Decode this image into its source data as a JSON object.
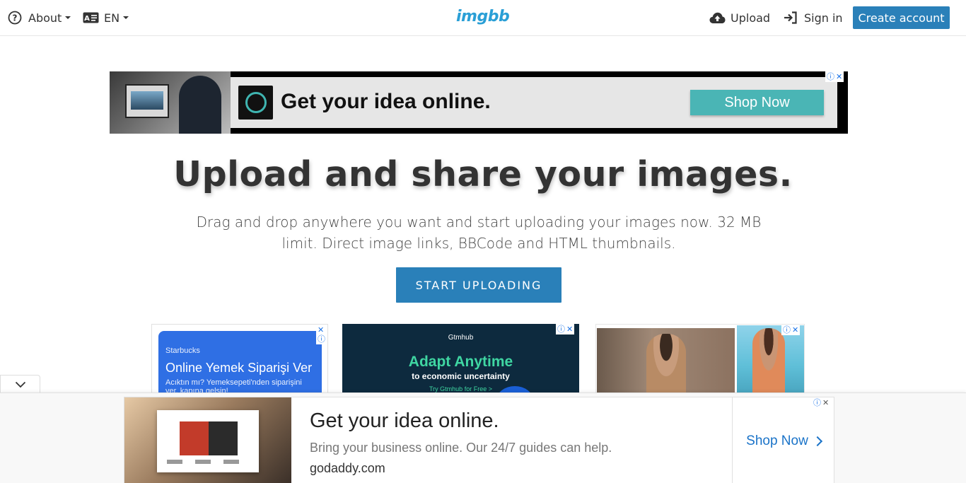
{
  "header": {
    "about_label": "About",
    "language_label": "EN",
    "logo_text": "imgbb",
    "upload_label": "Upload",
    "signin_label": "Sign in",
    "create_account_label": "Create account",
    "brand_color": "#2a9fd6",
    "button_color": "#2a80b9"
  },
  "top_ad": {
    "headline": "Get your idea online.",
    "cta": "Shop Now",
    "info_icon": "ⓘ",
    "close_icon": "✕"
  },
  "hero": {
    "title": "Upload and share your images.",
    "subtitle": "Drag and drop anywhere you want and start uploading your images now. 32 MB limit. Direct image links, BBCode and HTML thumbnails.",
    "start_button": "START UPLOADING"
  },
  "mid_ads": {
    "ad1": {
      "brand": "Starbucks",
      "headline": "Online Yemek Siparişi Ver",
      "subtext": "Acıktın mı? Yemeksepeti'nden siparişini ver, kapına gelsin!"
    },
    "ad2": {
      "brand": "Gtmhub",
      "headline": "Adapt Anytime",
      "subtext": "to economic uncertainty",
      "cta": "Try Gtmhub for Free >"
    }
  },
  "bottom_ad": {
    "headline": "Get your idea online.",
    "description": "Bring your business online. Our 24/7 guides can help.",
    "domain": "godaddy.com",
    "cta": "Shop Now"
  }
}
